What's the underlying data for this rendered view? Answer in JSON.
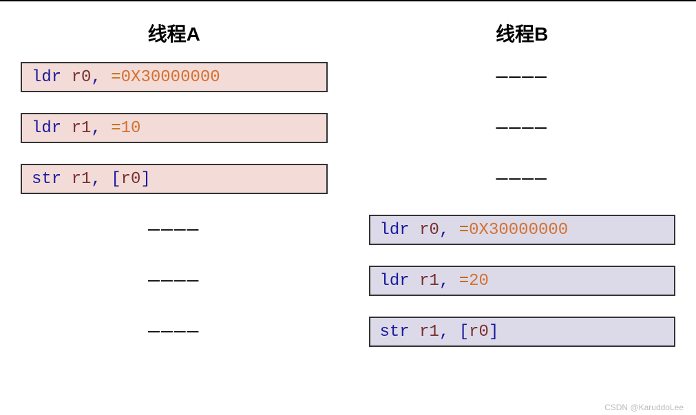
{
  "columnA": {
    "title": "线程A",
    "rows": [
      {
        "type": "code",
        "inst": "ldr",
        "reg1": "r0",
        "comma": ",",
        "eq": "=",
        "val": "0X30000000"
      },
      {
        "type": "code",
        "inst": "ldr",
        "reg1": "r1",
        "comma": ",",
        "eq": "= ",
        "val": "10"
      },
      {
        "type": "code",
        "inst": "str",
        "reg1": "r1",
        "comma": ",",
        "bracket_open": "[",
        "reg2": "r0",
        "bracket_close": "]"
      },
      {
        "type": "dash",
        "text": "————"
      },
      {
        "type": "dash",
        "text": "————"
      },
      {
        "type": "dash",
        "text": "————"
      }
    ]
  },
  "columnB": {
    "title": "线程B",
    "rows": [
      {
        "type": "dash",
        "text": "————"
      },
      {
        "type": "dash",
        "text": "————"
      },
      {
        "type": "dash",
        "text": "————"
      },
      {
        "type": "code",
        "inst": "ldr",
        "reg1": "r0",
        "comma": ",",
        "eq": "=",
        "val": "0X30000000"
      },
      {
        "type": "code",
        "inst": "ldr",
        "reg1": "r1",
        "comma": ",",
        "eq": "= ",
        "val": "20"
      },
      {
        "type": "code",
        "inst": "str",
        "reg1": "r1",
        "comma": ",",
        "bracket_open": "[",
        "reg2": "r0",
        "bracket_close": "]"
      }
    ]
  },
  "watermark": "CSDN @KaruddoLee"
}
